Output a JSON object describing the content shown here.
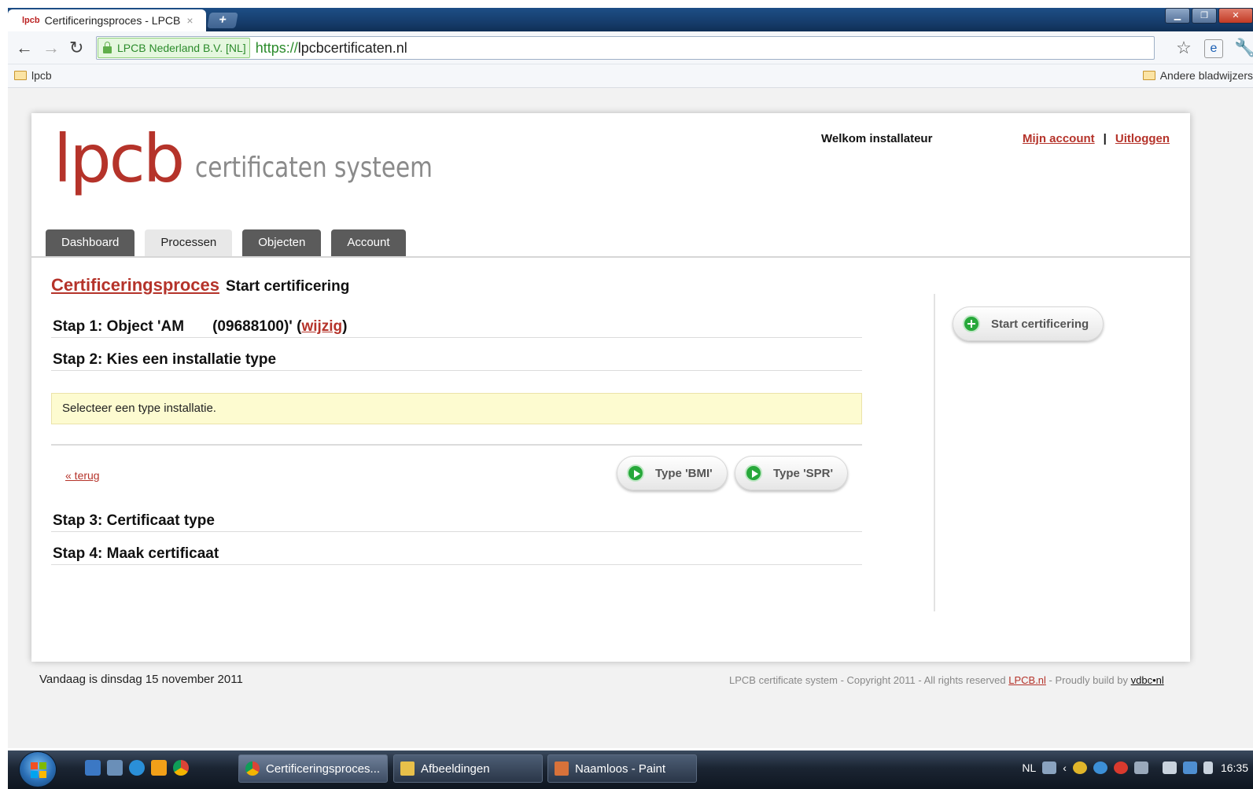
{
  "browser": {
    "tab_title": "Certificeringsproces - LPCB",
    "tab_close": "×",
    "tab_favicon": "lpcb",
    "newtab": "+",
    "ev_label": "LPCB Nederland B.V. [NL]",
    "url_scheme": "https://",
    "url_host": "lpcbcertificaten.nl",
    "bookmark_left": "lpcb",
    "bookmark_right": "Andere bladwijzers"
  },
  "header": {
    "logo_mark": "lpcb",
    "logo_text": "certificaten systeem",
    "welcome": "Welkom installateur",
    "account_link": "Mijn account",
    "separator": "|",
    "logout_link": "Uitloggen"
  },
  "nav": {
    "tabs": [
      {
        "label": "Dashboard"
      },
      {
        "label": "Processen"
      },
      {
        "label": "Objecten"
      },
      {
        "label": "Account"
      }
    ]
  },
  "main": {
    "heading_link": "Certificeringsproces",
    "heading_text": "Start certificering",
    "step1_prefix": "Stap 1: Object 'AM",
    "step1_code": "(09688100)' (",
    "step1_link": "wijzig",
    "step1_suffix": ")",
    "step2": "Stap 2: Kies een installatie type",
    "notice": "Selecteer een type installatie.",
    "back_link": "« terug",
    "btn_bmi": "Type 'BMI'",
    "btn_spr": "Type 'SPR'",
    "step3": "Stap 3: Certificaat type",
    "step4": "Stap 4: Maak certificaat"
  },
  "sidebar": {
    "start_button": "Start certificering"
  },
  "footer": {
    "date": "Vandaag is dinsdag 15 november 2011",
    "copyright_prefix": "LPCB certificate system - Copyright 2011 - All rights reserved ",
    "copyright_link": "LPCB.nl",
    "copyright_middle": " - Proudly build by ",
    "builder_link": "vdbc•nl"
  },
  "taskbar": {
    "tasks": [
      {
        "label": "Certificeringsproces..."
      },
      {
        "label": "Afbeeldingen"
      },
      {
        "label": "Naamloos - Paint"
      }
    ],
    "lang": "NL",
    "clock": "16:35"
  },
  "colors": {
    "brand_red": "#b5332a",
    "tab_dark": "#5b5b5b",
    "notice_bg": "#fdfbd0",
    "action_green": "#27a83a"
  }
}
